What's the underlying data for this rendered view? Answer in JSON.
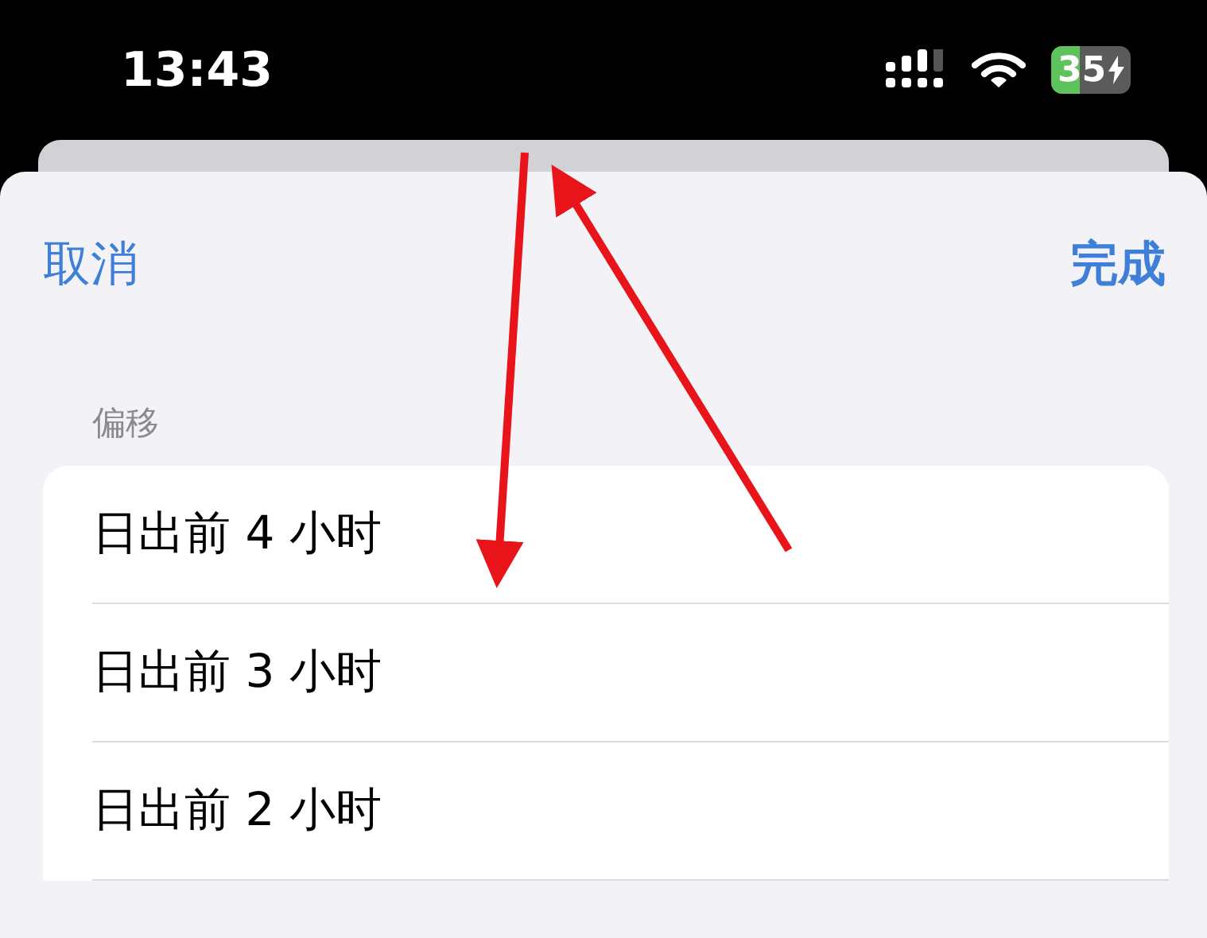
{
  "status_bar": {
    "time": "13:43",
    "battery": "35"
  },
  "nav": {
    "cancel": "取消",
    "done": "完成"
  },
  "section": {
    "header": "偏移",
    "rows": [
      {
        "label": "日出前 4 小时"
      },
      {
        "label": "日出前 3 小时"
      },
      {
        "label": "日出前 2 小时"
      }
    ]
  }
}
